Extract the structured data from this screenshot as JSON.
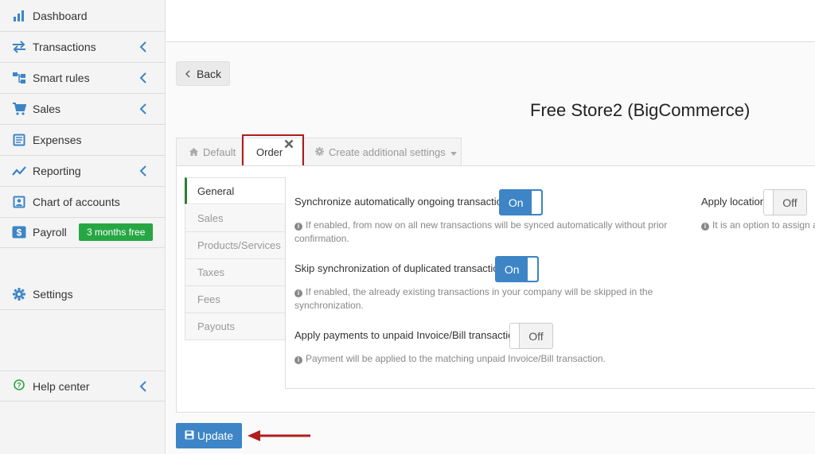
{
  "sidebar": {
    "items": [
      {
        "label": "Dashboard",
        "icon": "bar-chart-icon"
      },
      {
        "label": "Transactions",
        "icon": "transfer-arrows-icon"
      },
      {
        "label": "Smart rules",
        "icon": "sitemap-icon"
      },
      {
        "label": "Sales",
        "icon": "shopping-cart-icon"
      },
      {
        "label": "Expenses",
        "icon": "document-list-icon"
      },
      {
        "label": "Reporting",
        "icon": "line-chart-icon"
      },
      {
        "label": "Chart of accounts",
        "icon": "contact-card-icon"
      },
      {
        "label": "Payroll",
        "icon": "dollar-icon",
        "badge": "3 months free"
      },
      {
        "label": "Settings",
        "icon": "gear-icon"
      },
      {
        "label": "Help center",
        "icon": "question-circle-icon"
      }
    ]
  },
  "back_label": "Back",
  "page_title": "Free Store2 (BigCommerce)",
  "tabs": [
    {
      "label": "Default",
      "icon": "home-icon"
    },
    {
      "label": "Order",
      "icon": "close-icon"
    },
    {
      "label": "Create additional settings",
      "icon": "gear-icon"
    }
  ],
  "subnav": [
    "General",
    "Sales",
    "Products/Services",
    "Taxes",
    "Fees",
    "Payouts"
  ],
  "settings": [
    {
      "label": "Synchronize automatically ongoing transactions",
      "state": "On",
      "help_line1": "If enabled, from now on all new transactions will be synced automatically without prior",
      "help_line2": "confirmation."
    },
    {
      "label": "Skip synchronization of duplicated transactions",
      "state": "On",
      "help_line1": "If enabled, the already existing transactions in your company will be skipped in the",
      "help_line2": "synchronization."
    },
    {
      "label": "Apply payments to unpaid Invoice/Bill transactions",
      "state": "Off",
      "help_line1": "Payment will be applied to the matching unpaid Invoice/Bill transaction."
    },
    {
      "label": "Apply location",
      "state": "Off",
      "help_line1": "It is an option to assign a"
    }
  ],
  "update_label": "Update",
  "colors": {
    "accent": "#3d85c6",
    "badge": "#27a744",
    "highlight": "#b11c1c"
  }
}
